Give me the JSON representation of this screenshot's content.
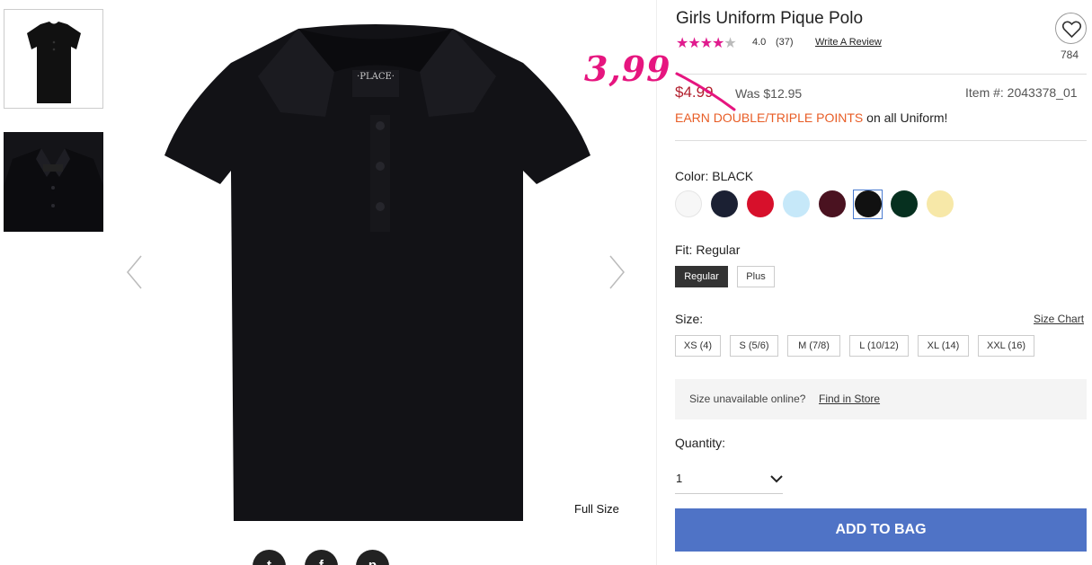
{
  "product": {
    "title": "Girls Uniform Pique Polo",
    "rating": "4.0",
    "review_count": "(37)",
    "write_review": "Write A Review",
    "favorites_count": "784",
    "price": "$4.99",
    "was_price": "Was $12.95",
    "item_number": "Item #: 2043378_01",
    "promo_highlight": "EARN DOUBLE/TRIPLE POINTS",
    "promo_rest": " on all Uniform!",
    "handwritten_price": "3,99",
    "stars_filled": 4,
    "stars_total": 5
  },
  "gallery": {
    "full_size_label": "Full Size",
    "brand_tag": "·PLACE·"
  },
  "color": {
    "label": "Color: BLACK",
    "swatches": [
      {
        "name": "white",
        "hex": "#f7f7f7"
      },
      {
        "name": "navy",
        "hex": "#1b2033"
      },
      {
        "name": "red",
        "hex": "#d7102b"
      },
      {
        "name": "light-blue",
        "hex": "#c6e8f9"
      },
      {
        "name": "burgundy",
        "hex": "#4a1220"
      },
      {
        "name": "black",
        "hex": "#111111"
      },
      {
        "name": "dark-green",
        "hex": "#06301f"
      },
      {
        "name": "yellow",
        "hex": "#f7e8a8"
      }
    ]
  },
  "fit": {
    "label": "Fit: Regular",
    "options": [
      "Regular",
      "Plus"
    ]
  },
  "size": {
    "label": "Size:",
    "chart_link": "Size Chart",
    "options": [
      "XS (4)",
      "S (5/6)",
      "M (7/8)",
      "L (10/12)",
      "XL (14)",
      "XXL (16)"
    ]
  },
  "availability": {
    "text": "Size unavailable online?",
    "find_store": "Find in Store"
  },
  "quantity": {
    "label": "Quantity:",
    "value": "1"
  },
  "cta": {
    "add_to_bag": "ADD TO BAG"
  },
  "social": {
    "twitter": "t",
    "facebook": "f",
    "pinterest": "p"
  }
}
